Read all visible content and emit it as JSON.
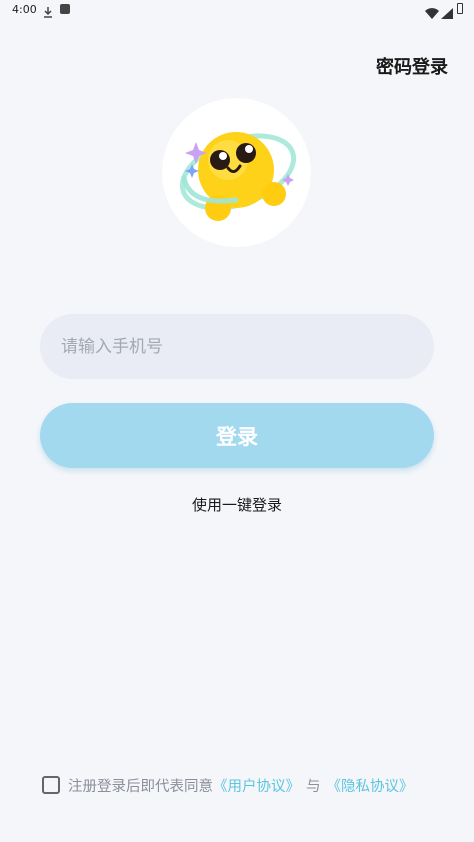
{
  "status_bar": {
    "time": "4:00",
    "icons": [
      "download-icon",
      "a-icon",
      "wifi-icon",
      "signal-icon",
      "battery-icon"
    ]
  },
  "header": {
    "password_login_label": "密码登录"
  },
  "avatar": {
    "icon": "emoji-mascot-icon"
  },
  "form": {
    "phone_placeholder": "请输入手机号",
    "login_label": "登录",
    "one_click_label": "使用一键登录"
  },
  "agreement": {
    "prefix": "注册登录后即代表同意",
    "user_agreement": "《用户协议》",
    "connector": "与",
    "privacy_policy": "《隐私协议》"
  },
  "colors": {
    "background": "#f5f6fa",
    "input_bg": "#e9ecf4",
    "button_bg": "#a3d9ee",
    "link": "#5bc6e0"
  }
}
